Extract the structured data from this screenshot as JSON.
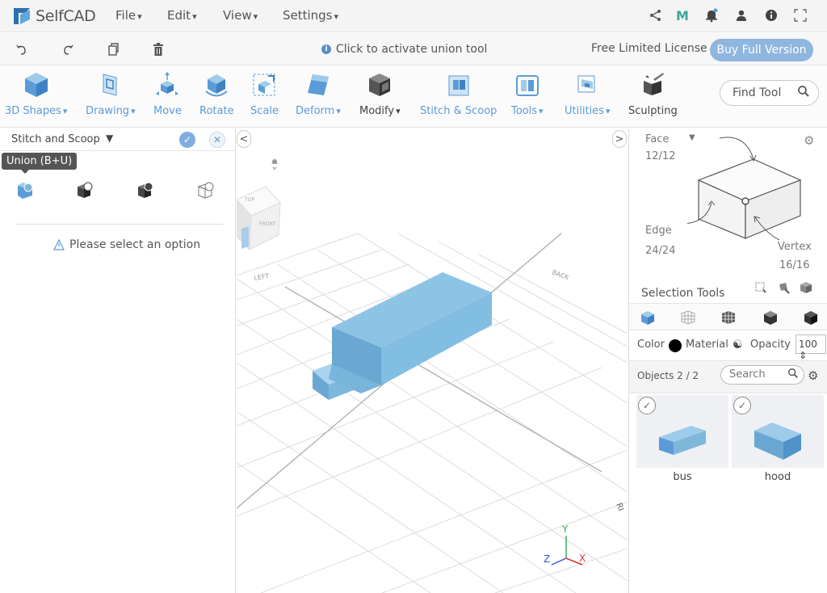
{
  "app": {
    "name": "SelfCAD",
    "menus": [
      "File",
      "Edit",
      "View",
      "Settings"
    ],
    "icons": [
      "share-icon",
      "m-icon",
      "notification-bell-icon",
      "user-icon",
      "info-icon",
      "fullscreen-icon"
    ]
  },
  "bar2": {
    "hint": "Click to activate union tool",
    "license": "Free Limited License",
    "buy": "Buy Full Version"
  },
  "toolbar": {
    "tools": [
      {
        "label": "3D Shapes",
        "dropdown": true
      },
      {
        "label": "Drawing",
        "dropdown": true
      },
      {
        "label": "Move",
        "dropdown": false
      },
      {
        "label": "Rotate",
        "dropdown": false
      },
      {
        "label": "Scale",
        "dropdown": false
      },
      {
        "label": "Deform",
        "dropdown": true
      },
      {
        "label": "Modify",
        "dropdown": true
      },
      {
        "label": "Stitch & Scoop",
        "dropdown": false
      },
      {
        "label": "Tools",
        "dropdown": true
      },
      {
        "label": "Utilities",
        "dropdown": true
      },
      {
        "label": "Sculpting",
        "dropdown": false
      }
    ],
    "find_tool": "Find Tool"
  },
  "left_panel": {
    "title": "Stitch and Scoop",
    "tooltip": "Union (B+U)",
    "message": "Please select an option"
  },
  "viewport": {
    "axes": {
      "x": "X",
      "y": "Y",
      "z": "Z"
    },
    "cube_labels": {
      "top": "TOP",
      "front": "FRONT",
      "left": "LEFT"
    },
    "grid_labels": {
      "left": "LEFT",
      "back": "BACK",
      "right": "RI"
    }
  },
  "right_panel": {
    "face_label": "Face",
    "face_count": "12/12",
    "edge_label": "Edge",
    "edge_count": "24/24",
    "vertex_label": "Vertex",
    "vertex_count": "16/16",
    "selection_tools": "Selection Tools",
    "color_label": "Color",
    "material_label": "Material",
    "opacity_label": "Opacity",
    "opacity_value": "100",
    "objects_label": "Objects 2 / 2",
    "search_placeholder": "Search",
    "objects": [
      {
        "name": "bus"
      },
      {
        "name": "hood"
      }
    ]
  },
  "colors": {
    "accent": "#5b9bd8",
    "object_blue": "#7fb7db",
    "buy_button": "#8fb6df"
  }
}
